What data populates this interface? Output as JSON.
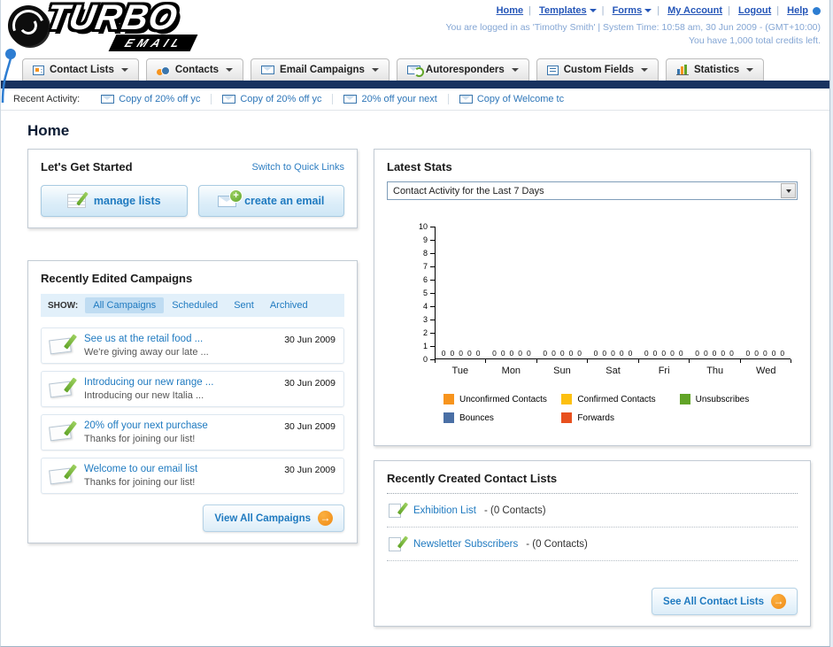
{
  "logo": {
    "title": "TURBO",
    "subtitle": "EMAIL"
  },
  "header": {
    "nav": [
      {
        "label": "Home"
      },
      {
        "label": "Templates",
        "dropdown": true
      },
      {
        "label": "Forms",
        "dropdown": true
      },
      {
        "label": "My Account"
      },
      {
        "label": "Logout"
      },
      {
        "label": "Help"
      }
    ],
    "login_info": "You are logged in as 'Timothy Smith' | System Time: 10:58 am, 30 Jun 2009 - (GMT+10:00)",
    "credits": "You have 1,000 total credits left."
  },
  "main_nav": {
    "tabs": [
      {
        "label": "Contact Lists",
        "icon": "contact-lists-icon"
      },
      {
        "label": "Contacts",
        "icon": "contacts-icon"
      },
      {
        "label": "Email Campaigns",
        "icon": "email-campaigns-icon"
      },
      {
        "label": "Autoresponders",
        "icon": "autoresponders-icon"
      },
      {
        "label": "Custom Fields",
        "icon": "custom-fields-icon"
      },
      {
        "label": "Statistics",
        "icon": "statistics-icon"
      }
    ]
  },
  "recent_activity": {
    "label": "Recent Activity:",
    "items": [
      {
        "text": "Copy of 20% off yc"
      },
      {
        "text": "Copy of 20% off yc"
      },
      {
        "text": "20% off your next"
      },
      {
        "text": "Copy of Welcome tc"
      }
    ]
  },
  "page_title": "Home",
  "get_started": {
    "title": "Let's Get Started",
    "switch_link": "Switch to Quick Links",
    "manage_lists_label": "manage lists",
    "create_email_label": "create an email"
  },
  "campaigns": {
    "title": "Recently Edited Campaigns",
    "show_label": "SHOW:",
    "filters": [
      "All Campaigns",
      "Scheduled",
      "Sent",
      "Archived"
    ],
    "active_filter": "All Campaigns",
    "items": [
      {
        "title": "See us at the retail food ...",
        "subtitle": "We're giving away our late ...",
        "date": "30 Jun 2009"
      },
      {
        "title": "Introducing our new range ...",
        "subtitle": "Introducing our new Italia ...",
        "date": "30 Jun 2009"
      },
      {
        "title": "20% off your next purchase",
        "subtitle": "Thanks for joining our list!",
        "date": "30 Jun 2009"
      },
      {
        "title": "Welcome to our email list",
        "subtitle": "Thanks for joining our list!",
        "date": "30 Jun 2009"
      }
    ],
    "view_all_label": "View All Campaigns"
  },
  "stats": {
    "title": "Latest Stats",
    "dropdown_value": "Contact Activity for the Last 7 Days",
    "chart_data": {
      "type": "bar",
      "title": "Contact Activity for the Last 7 Days",
      "categories": [
        "Tue",
        "Mon",
        "Sun",
        "Sat",
        "Fri",
        "Thu",
        "Wed"
      ],
      "series": [
        {
          "name": "Unconfirmed Contacts",
          "color": "#f7941d",
          "values": [
            0,
            0,
            0,
            0,
            0,
            0,
            0
          ]
        },
        {
          "name": "Confirmed Contacts",
          "color": "#fdc010",
          "values": [
            0,
            0,
            0,
            0,
            0,
            0,
            0
          ]
        },
        {
          "name": "Unsubscribes",
          "color": "#61a427",
          "values": [
            0,
            0,
            0,
            0,
            0,
            0,
            0
          ]
        },
        {
          "name": "Bounces",
          "color": "#4a6fa5",
          "values": [
            0,
            0,
            0,
            0,
            0,
            0,
            0
          ]
        },
        {
          "name": "Forwards",
          "color": "#e8501e",
          "values": [
            0,
            0,
            0,
            0,
            0,
            0,
            0
          ]
        }
      ],
      "ylim": [
        0,
        10
      ],
      "ytick_step": 1,
      "grid": false,
      "legend_position": "bottom"
    }
  },
  "contact_lists": {
    "title": "Recently Created Contact Lists",
    "items": [
      {
        "name": "Exhibition List",
        "suffix": "- (0 Contacts)"
      },
      {
        "name": "Newsletter Subscribers",
        "suffix": "- (0 Contacts)"
      }
    ],
    "see_all_label": "See All Contact Lists"
  }
}
